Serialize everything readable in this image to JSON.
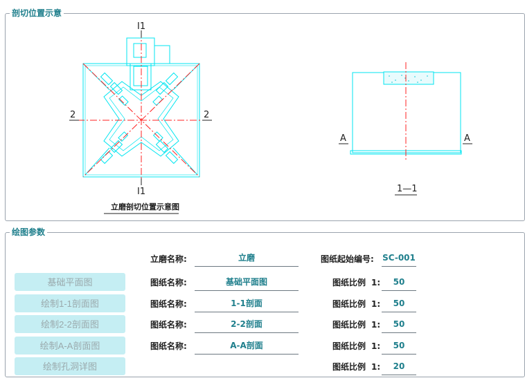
{
  "section_view": {
    "title": "剖切位置示意",
    "plan": {
      "top_label": "I1",
      "bottom_label": "I1",
      "left_label": "2",
      "right_label": "2",
      "caption": "立磨剖切位置示意图"
    },
    "elevation": {
      "left_label": "A",
      "right_label": "A",
      "caption": "1—1"
    }
  },
  "params": {
    "title": "绘图参数",
    "buttons": [
      {
        "label": "基础平面图"
      },
      {
        "label": "绘制1-1剖面图"
      },
      {
        "label": "绘制2-2剖面图"
      },
      {
        "label": "绘制A-A剖面图"
      },
      {
        "label": "绘制孔洞详图"
      }
    ],
    "mill_name_label": "立磨名称:",
    "mill_name_value": "立磨",
    "start_no_label": "图纸起始编号:",
    "start_no_value": "SC-001",
    "drawing_name_label": "图纸名称:",
    "scale_label": "图纸比例",
    "scale_prefix": "1:",
    "rows": [
      {
        "name": "基础平面图",
        "scale": "50"
      },
      {
        "name": "1-1剖面",
        "scale": "50"
      },
      {
        "name": "2-2剖面",
        "scale": "50"
      },
      {
        "name": "A-A剖面",
        "scale": "50"
      },
      {
        "name": "",
        "scale": "20"
      }
    ]
  },
  "colors": {
    "cyan": "#00e5f0",
    "red": "#ff2020",
    "title": "#1f7f8c",
    "button_bg": "#c5eef3"
  }
}
